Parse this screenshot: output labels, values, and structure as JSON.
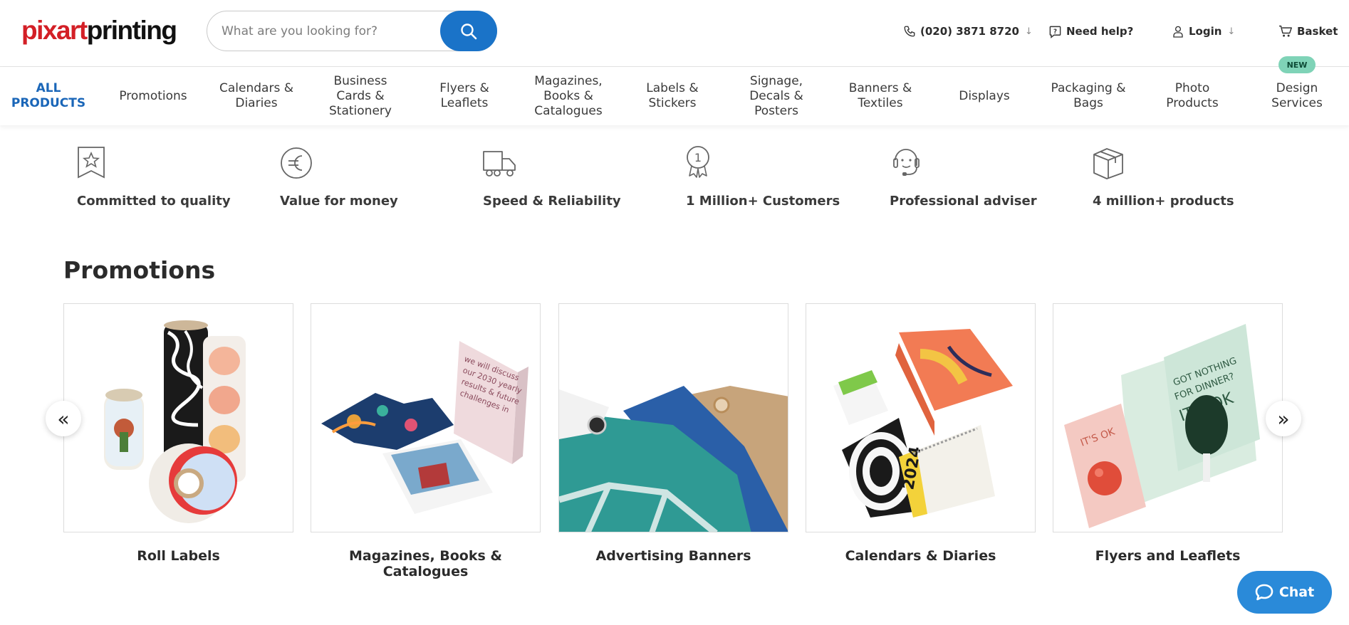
{
  "header": {
    "logo": {
      "part1": "pixart",
      "part2": "printing"
    },
    "search": {
      "placeholder": "What are you looking for?",
      "value": "",
      "icon": "search-icon"
    },
    "phone": {
      "label": "(020) 3871 8720",
      "icon": "phone-icon",
      "chevron": "↓"
    },
    "help": {
      "label": "Need help?",
      "icon": "help-icon"
    },
    "login": {
      "label": "Login",
      "icon": "user-icon",
      "chevron": "↓"
    },
    "basket": {
      "label": "Basket",
      "icon": "cart-icon"
    }
  },
  "nav": {
    "items": [
      {
        "label": "ALL\nPRODUCTS",
        "active": true
      },
      {
        "label": "Promotions"
      },
      {
        "label": "Calendars &\nDiaries"
      },
      {
        "label": "Business\nCards &\nStationery"
      },
      {
        "label": "Flyers &\nLeaflets"
      },
      {
        "label": "Magazines,\nBooks &\nCatalogues"
      },
      {
        "label": "Labels &\nStickers"
      },
      {
        "label": "Signage,\nDecals &\nPosters"
      },
      {
        "label": "Banners &\nTextiles"
      },
      {
        "label": "Displays"
      },
      {
        "label": "Packaging &\nBags"
      },
      {
        "label": "Photo\nProducts"
      },
      {
        "label": "Design\nServices"
      }
    ],
    "new_badge": "NEW"
  },
  "features": [
    {
      "label": "Committed to quality",
      "icon": "quality-badge-icon"
    },
    {
      "label": "Value for money",
      "icon": "euro-icon"
    },
    {
      "label": "Speed & Reliability",
      "icon": "truck-icon"
    },
    {
      "label": "1 Million+ Customers",
      "icon": "medal-icon"
    },
    {
      "label": "Professional adviser",
      "icon": "headset-icon"
    },
    {
      "label": "4 million+ products",
      "icon": "box-icon"
    }
  ],
  "promotions": {
    "title": "Promotions",
    "prev_icon": "«",
    "next_icon": "»",
    "cards": [
      {
        "title": "Roll Labels"
      },
      {
        "title": "Magazines, Books & Catalogues"
      },
      {
        "title": "Advertising Banners"
      },
      {
        "title": "Calendars & Diaries"
      },
      {
        "title": "Flyers and Leaflets"
      }
    ]
  },
  "chat": {
    "label": "Chat",
    "icon": "chat-bubble-icon"
  },
  "colors": {
    "brand_red": "#d31f26",
    "primary_blue": "#1a73c8",
    "nav_active": "#1a66b8",
    "chat_blue": "#2a8ad9",
    "new_badge": "#7fd3b7"
  }
}
